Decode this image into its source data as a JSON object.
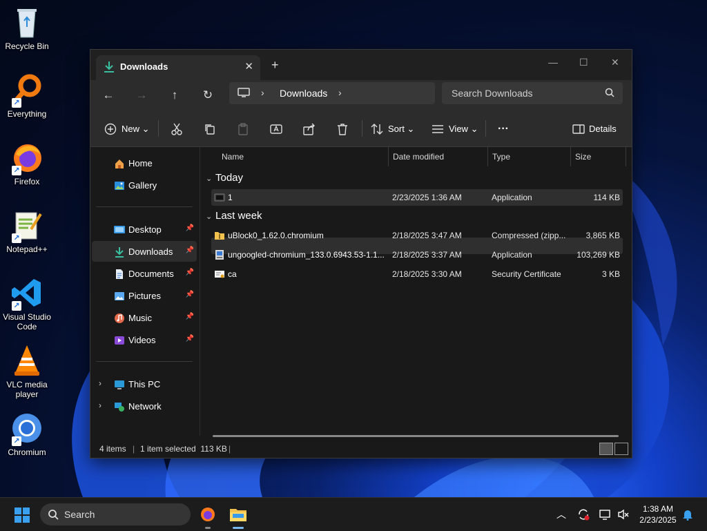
{
  "desktop": {
    "icons": [
      {
        "label": "Recycle Bin"
      },
      {
        "label": "Everything"
      },
      {
        "label": "Firefox"
      },
      {
        "label": "Notepad++"
      },
      {
        "label": "Visual Studio Code"
      },
      {
        "label": "VLC media player"
      },
      {
        "label": "Chromium"
      }
    ]
  },
  "window": {
    "tab_title": "Downloads",
    "address": {
      "crumb": "Downloads"
    },
    "search": {
      "placeholder": "Search Downloads"
    },
    "toolbar": {
      "new_label": "New",
      "sort_label": "Sort",
      "view_label": "View",
      "details_label": "Details"
    },
    "sidebar": {
      "items": [
        {
          "label": "Home"
        },
        {
          "label": "Gallery"
        },
        {
          "label": "Desktop"
        },
        {
          "label": "Downloads"
        },
        {
          "label": "Documents"
        },
        {
          "label": "Pictures"
        },
        {
          "label": "Music"
        },
        {
          "label": "Videos"
        },
        {
          "label": "This PC"
        },
        {
          "label": "Network"
        }
      ]
    },
    "columns": {
      "name": "Name",
      "date": "Date modified",
      "type": "Type",
      "size": "Size"
    },
    "groups": [
      {
        "label": "Today"
      },
      {
        "label": "Last week"
      }
    ],
    "files": [
      {
        "name": "1",
        "date": "2/23/2025 1:36 AM",
        "type": "Application",
        "size": "114 KB"
      },
      {
        "name": "uBlock0_1.62.0.chromium",
        "date": "2/18/2025 3:47 AM",
        "type": "Compressed (zipp...",
        "size": "3,865 KB"
      },
      {
        "name": "ungoogled-chromium_133.0.6943.53-1.1...",
        "date": "2/18/2025 3:37 AM",
        "type": "Application",
        "size": "103,269 KB"
      },
      {
        "name": "ca",
        "date": "2/18/2025 3:30 AM",
        "type": "Security Certificate",
        "size": "3 KB"
      }
    ],
    "status": {
      "count": "4 items",
      "selected": "1 item selected  113 KB"
    }
  },
  "taskbar": {
    "search_label": "Search",
    "time": "1:38 AM",
    "date": "2/23/2025"
  },
  "colors": {
    "accent": "#2b8fe0",
    "window_bg": "#191919",
    "chrome_bg": "#2c2c2c"
  }
}
